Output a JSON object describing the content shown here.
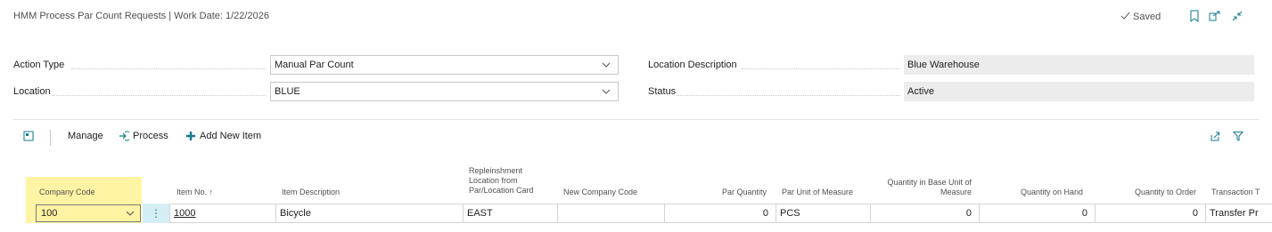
{
  "header": {
    "title": "HMM Process Par Count Requests | Work Date: 1/22/2026",
    "saved_label": "Saved",
    "icons": [
      "checkmark-icon",
      "bookmark-icon",
      "open-in-new-icon",
      "collapse-icon"
    ]
  },
  "fields": {
    "action_type": {
      "label": "Action Type",
      "value": "Manual Par Count"
    },
    "location": {
      "label": "Location",
      "value": "BLUE"
    },
    "location_description": {
      "label": "Location Description",
      "value": "Blue Warehouse"
    },
    "status": {
      "label": "Status",
      "value": "Active"
    }
  },
  "actions": {
    "manage": "Manage",
    "process": "Process",
    "add_new_item": "Add New Item",
    "icons": [
      "layout-icon",
      "process-icon",
      "plus-icon",
      "share-icon",
      "filter-icon"
    ]
  },
  "table": {
    "columns": {
      "company_code": "Company Code",
      "item_no": "Item No. ↑",
      "item_description": "Item Description",
      "repl_line1": "Repleinshment",
      "repl_line2": "Location from",
      "repl_line3": "Par/Location Card",
      "new_company_code": "New Company Code",
      "par_quantity": "Par Quantity",
      "par_uom": "Par Unit of Measure",
      "qty_base_line1": "Quantity in Base Unit of",
      "qty_base_line2": "Measure",
      "qty_on_hand": "Quantity on Hand",
      "qty_to_order": "Quantity to Order",
      "transaction": "Transaction T"
    },
    "rows": [
      {
        "company_code": "100",
        "item_no": "1000",
        "item_description": "Bicycle",
        "replenishment_location": "EAST",
        "new_company_code": "",
        "par_quantity": "0",
        "par_uom": "PCS",
        "qty_base_uom": "0",
        "qty_on_hand": "0",
        "qty_to_order": "0",
        "transaction": "Transfer Pr"
      }
    ]
  },
  "colors": {
    "accent": "#117a8b",
    "highlight": "#fff4a3",
    "readonly_bg": "#ececec"
  }
}
